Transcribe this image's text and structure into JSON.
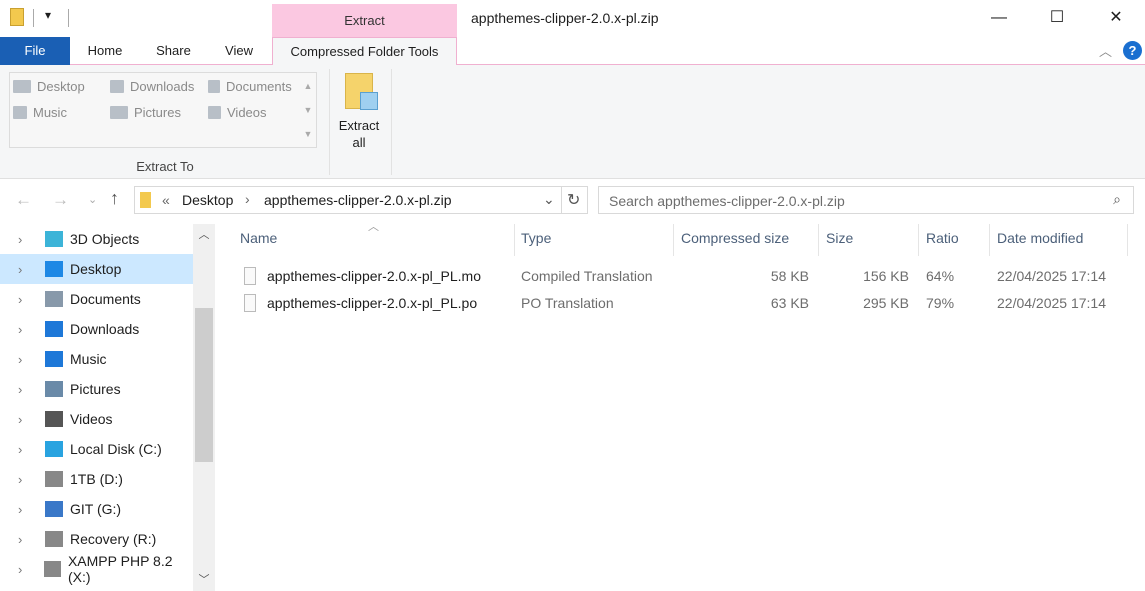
{
  "window": {
    "title": "appthemes-clipper-2.0.x-pl.zip",
    "context_tab": "Extract",
    "minimize": "—",
    "maximize": "☐",
    "close": "✕"
  },
  "tabs": {
    "file": "File",
    "home": "Home",
    "share": "Share",
    "view": "View",
    "compressed": "Compressed Folder Tools"
  },
  "ribbon": {
    "gallery": [
      "Desktop",
      "Downloads",
      "Documents",
      "Music",
      "Pictures",
      "Videos"
    ],
    "group_label": "Extract To",
    "extract_all_1": "Extract",
    "extract_all_2": "all"
  },
  "address": {
    "prefix": "«",
    "crumbs": [
      "Desktop",
      "appthemes-clipper-2.0.x-pl.zip"
    ],
    "search_placeholder": "Search appthemes-clipper-2.0.x-pl.zip"
  },
  "nav": [
    "3D Objects",
    "Desktop",
    "Documents",
    "Downloads",
    "Music",
    "Pictures",
    "Videos",
    "Local Disk (C:)",
    "1TB (D:)",
    "GIT (G:)",
    "Recovery (R:)",
    "XAMPP PHP 8.2 (X:)"
  ],
  "columns": [
    "Name",
    "Type",
    "Compressed size",
    "Size",
    "Ratio",
    "Date modified"
  ],
  "files": [
    {
      "name": "appthemes-clipper-2.0.x-pl_PL.mo",
      "type": "Compiled Translation",
      "csize": "58 KB",
      "size": "156 KB",
      "ratio": "64%",
      "date": "22/04/2025 17:14"
    },
    {
      "name": "appthemes-clipper-2.0.x-pl_PL.po",
      "type": "PO Translation",
      "csize": "63 KB",
      "size": "295 KB",
      "ratio": "79%",
      "date": "22/04/2025 17:14"
    }
  ]
}
